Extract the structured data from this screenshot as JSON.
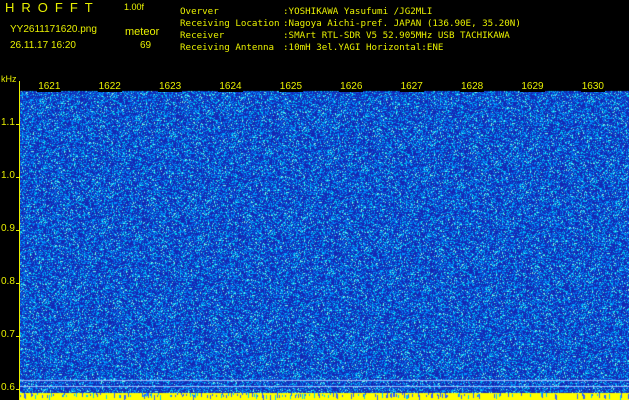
{
  "header": {
    "app_title": "HROFFT",
    "app_version": "1.00f",
    "file_name": "YY2611171620.png",
    "obs_time": "26.11.17 16:20",
    "meteor_label": "meteor",
    "meteor_count": "69"
  },
  "info": {
    "observer_key": "Overver",
    "observer_val": ":YOSHIKAWA Yasufumi /JG2MLI",
    "location_key": "Receiving Location",
    "location_val": ":Nagoya Aichi-pref. JAPAN (136.90E, 35.20N)",
    "receiver_key": "Receiver",
    "receiver_val": ":SMArt RTL-SDR V5 52.905MHz USB TACHIKAWA",
    "antenna_key": "Receiving Antenna",
    "antenna_val": ":10mH 3el.YAGI Horizontal:ENE"
  },
  "colors": {
    "label": "#e8f000",
    "background": "#000000",
    "noise_low": "#1428b0",
    "noise_high": "#00e0ff",
    "baseline": "#ffff00"
  },
  "chart_data": {
    "type": "heatmap",
    "title": "",
    "ylabel": "kHz",
    "xlabel": "",
    "x_ticks": [
      "1621",
      "1622",
      "1623",
      "1624",
      "1625",
      "1626",
      "1627",
      "1628",
      "1629",
      "1630"
    ],
    "y_ticks": [
      "1.1",
      "1.0",
      "0.9",
      "0.8",
      "0.7",
      "0.6"
    ],
    "y_values": [
      1.1,
      1.0,
      0.9,
      0.8,
      0.7,
      0.6
    ],
    "ylim": [
      0.58,
      1.18
    ],
    "xlim": [
      1620.5,
      1630.6
    ]
  }
}
